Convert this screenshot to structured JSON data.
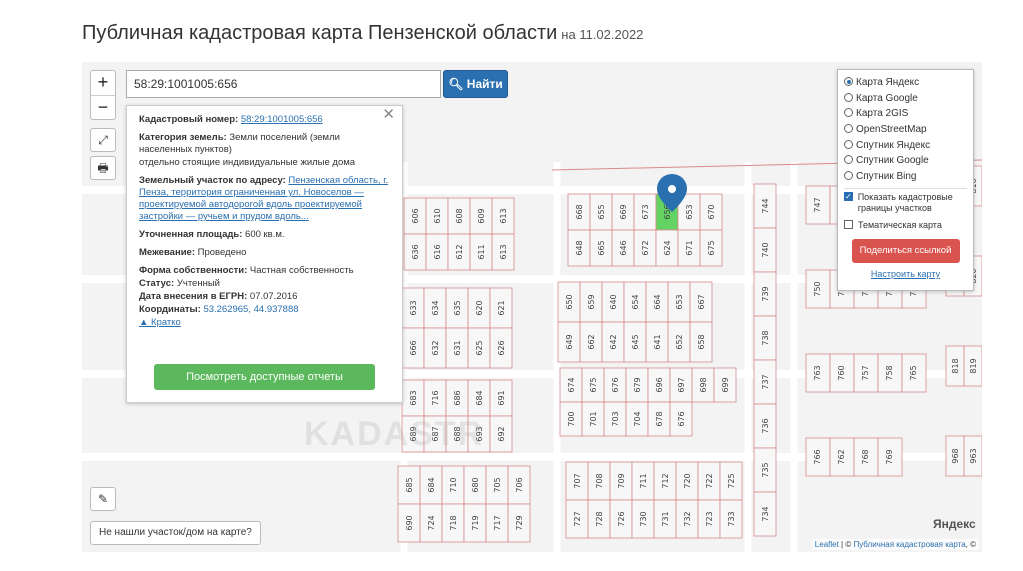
{
  "header": {
    "title": "Публичная кадастровая карта Пензенской области",
    "subtitle": "на 11.02.2022"
  },
  "search": {
    "value": "58:29:1001005:656",
    "button_label": "Найти"
  },
  "zoom": {
    "in_label": "+",
    "out_label": "−"
  },
  "info": {
    "cadastral_number_label": "Кадастровый номер:",
    "cadastral_number": "58:29:1001005:656",
    "land_category_label": "Категория земель:",
    "land_category": "Земли поселений (земли населенных пунктов)",
    "land_use": "отдельно стоящие индивидуальные жилые дома",
    "address_label": "Земельный участок по адресу:",
    "address": "Пензенская область, г. Пенза, территория ограниченная ул. Новоселов — проектируемой автодорогой вдоль проектируемой застройки — ручьем и прудом вдоль...",
    "area_label": "Уточненная площадь:",
    "area": "600 кв.м.",
    "survey_label": "Межевание:",
    "survey": "Проведено",
    "ownership_label": "Форма собственности:",
    "ownership": "Частная собственность",
    "status_label": "Статус:",
    "status": "Учтенный",
    "egrn_date_label": "Дата внесения в ЕГРН:",
    "egrn_date": "07.07.2016",
    "coords_label": "Координаты:",
    "coords": "53.262965, 44.937888",
    "brief_label": "▲ Кратко",
    "reports_button": "Посмотреть доступные отчеты"
  },
  "layers": {
    "options": [
      "Карта Яндекс",
      "Карта Google",
      "Карта 2GIS",
      "OpenStreetMap",
      "Спутник Яндекс",
      "Спутник Google",
      "Спутник Bing"
    ],
    "selected": "Карта Яндекс",
    "show_boundaries_label": "Показать кадастровые границы участков",
    "show_boundaries": true,
    "thematic_label": "Тематическая карта",
    "thematic": false,
    "share_button": "Поделиться ссылкой",
    "configure_link": "Настроить карту"
  },
  "not_found_button": "Не нашли участок/дом на карте?",
  "map_brand": "Яндекс",
  "attribution": {
    "leaflet": "Leaflet",
    "separator": " | © ",
    "source": "Публичная кадастровая карта",
    "tail": ", ©"
  },
  "colors": {
    "selected_plot": "#63d463",
    "marker": "#2a6fb0",
    "parcel_border": "#d98a8a",
    "search_button": "#2a6fb0",
    "report_button": "#5cb85c",
    "share_button": "#d9534f"
  },
  "parcels": {
    "block_a_top": [
      "606",
      "610",
      "608",
      "609",
      "613"
    ],
    "block_a_bottom": [
      "636",
      "616",
      "612",
      "611",
      "613"
    ],
    "block_b_top": [
      "668",
      "655",
      "669",
      "673",
      "656",
      "653",
      "670"
    ],
    "block_b_bottom": [
      "648",
      "665",
      "646",
      "672",
      "624",
      "671",
      "675"
    ],
    "block_c_top": [
      "633",
      "634",
      "635",
      "620",
      "621"
    ],
    "block_c_bottom": [
      "666",
      "632",
      "631",
      "625",
      "626"
    ],
    "block_d_top": [
      "650",
      "659",
      "640",
      "654",
      "664",
      "653",
      "667"
    ],
    "block_d_bottom": [
      "649",
      "662",
      "642",
      "645",
      "641",
      "652",
      "658"
    ],
    "block_e_top": [
      "683",
      "716",
      "686",
      "684",
      "691"
    ],
    "block_e_bottom": [
      "689",
      "687",
      "688",
      "693",
      "692"
    ],
    "block_f_top": [
      "674",
      "675",
      "676",
      "679",
      "696",
      "697",
      "698",
      "699"
    ],
    "block_f_bottom": [
      "700",
      "701",
      "703",
      "704",
      "678",
      "676"
    ],
    "block_g_top": [
      "685",
      "684",
      "710",
      "680",
      "705",
      "706"
    ],
    "block_g_bottom": [
      "690",
      "724",
      "718",
      "719",
      "717",
      "729"
    ],
    "block_h_top": [
      "707",
      "708",
      "709",
      "711",
      "712",
      "720",
      "722",
      "725"
    ],
    "block_h_bottom": [
      "727",
      "728",
      "726",
      "730",
      "731",
      "732",
      "723",
      "733"
    ],
    "column_right": [
      "744",
      "740",
      "739",
      "738",
      "737",
      "736",
      "735",
      "734"
    ],
    "right_block": [
      "747",
      "884",
      "885",
      "751",
      "764",
      "750",
      "752",
      "756",
      "755",
      "746",
      "763",
      "760",
      "757",
      "758",
      "765",
      "766",
      "762",
      "768",
      "769"
    ],
    "far_right": [
      "1298",
      "816",
      "817",
      "820",
      "818",
      "819",
      "968",
      "963"
    ]
  }
}
